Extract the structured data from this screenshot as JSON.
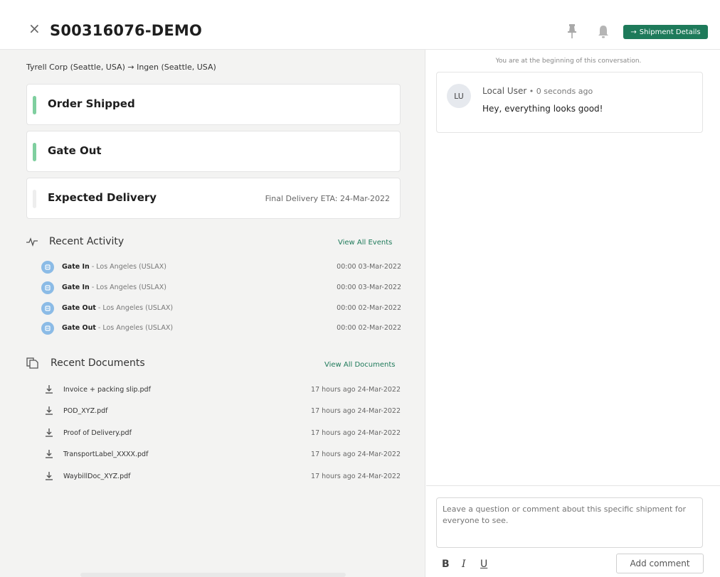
{
  "header": {
    "close_glyph": "×",
    "title": "S00316076-DEMO",
    "shipment_details_label": "Shipment Details",
    "shipment_details_arrow": "→",
    "accent": "#1e7a5a"
  },
  "summary": {
    "route": "Tyrell Corp (Seattle, USA) → Ingen (Seattle, USA)"
  },
  "milestones": [
    {
      "label": "Order Shipped",
      "status_color": "#7fcf9f",
      "eta": ""
    },
    {
      "label": "Gate Out",
      "status_color": "#7fcf9f",
      "eta": ""
    },
    {
      "label": "Expected Delivery",
      "status_color": "#eeeeee",
      "eta": "Final Delivery ETA: 24-Mar-2022"
    }
  ],
  "recent_activity": {
    "title": "Recent Activity",
    "view_all_label": "View All Events",
    "events": [
      {
        "type": "Gate In",
        "location": " - Los Angeles (USLAX)",
        "time": "00:00 03-Mar-2022"
      },
      {
        "type": "Gate In",
        "location": " - Los Angeles (USLAX)",
        "time": "00:00 03-Mar-2022"
      },
      {
        "type": "Gate Out",
        "location": " - Los Angeles (USLAX)",
        "time": "00:00 02-Mar-2022"
      },
      {
        "type": "Gate Out",
        "location": " - Los Angeles (USLAX)",
        "time": "00:00 02-Mar-2022"
      }
    ]
  },
  "recent_documents": {
    "title": "Recent Documents",
    "view_all_label": "View All Documents",
    "documents": [
      {
        "name": "Invoice + packing slip.pdf",
        "time": "17 hours ago  24-Mar-2022"
      },
      {
        "name": "POD_XYZ.pdf",
        "time": "17 hours ago  24-Mar-2022"
      },
      {
        "name": "Proof of Delivery.pdf",
        "time": "17 hours ago  24-Mar-2022"
      },
      {
        "name": "TransportLabel_XXXX.pdf",
        "time": "17 hours ago  24-Mar-2022"
      },
      {
        "name": "WaybillDoc_XYZ.pdf",
        "time": "17 hours ago  24-Mar-2022"
      }
    ]
  },
  "conversation": {
    "start_notice": "You are at the beginning of this conversation.",
    "messages": [
      {
        "initials": "LU",
        "author": "Local User",
        "separator": " • ",
        "ago": "0 seconds ago",
        "text": "Hey, everything looks good!"
      }
    ],
    "composer": {
      "placeholder": "Leave a question or comment about this specific shipment for everyone to see.",
      "bold_label": "B",
      "italic_label": "I",
      "underline_label": "U",
      "submit_label": "Add comment"
    }
  }
}
